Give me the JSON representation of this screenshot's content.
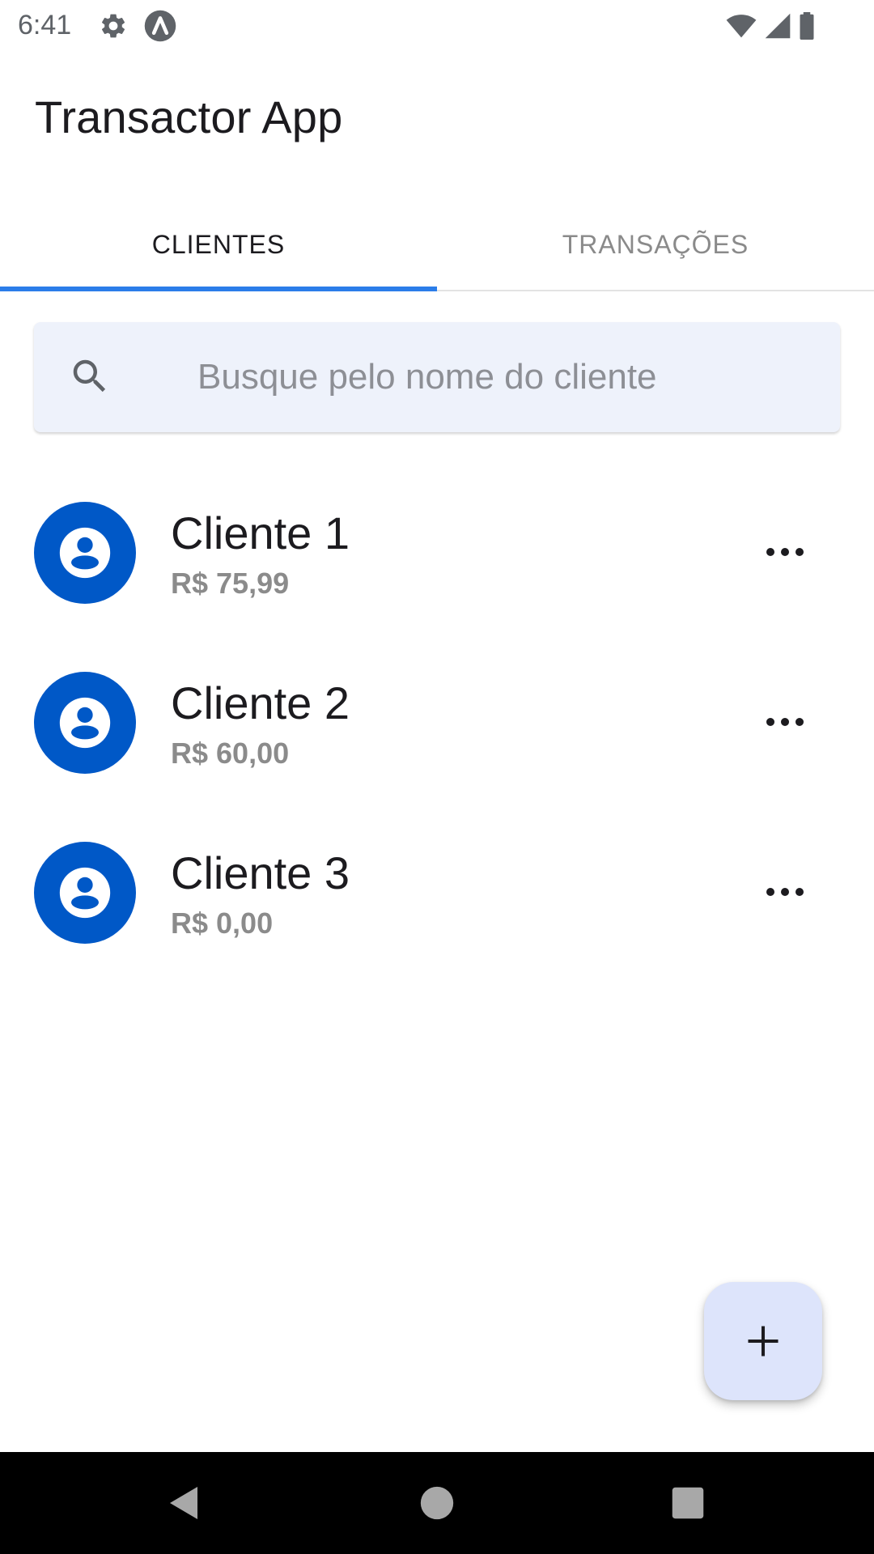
{
  "status_bar": {
    "time": "6:41",
    "icons": [
      "gear-icon",
      "a-badge-icon",
      "wifi-icon",
      "signal-icon",
      "battery-icon"
    ]
  },
  "app_bar": {
    "title": "Transactor App"
  },
  "tabs": [
    {
      "label": "CLIENTES",
      "active": true
    },
    {
      "label": "TRANSAÇÕES",
      "active": false
    }
  ],
  "search": {
    "placeholder": "Busque pelo nome do cliente",
    "value": ""
  },
  "clients": [
    {
      "name": "Cliente 1",
      "amount": "R$ 75,99"
    },
    {
      "name": "Cliente 2",
      "amount": "R$ 60,00"
    },
    {
      "name": "Cliente 3",
      "amount": "R$ 0,00"
    }
  ],
  "fab": {
    "icon": "plus-icon"
  },
  "nav_bar": {
    "icons": [
      "back-icon",
      "home-icon",
      "recents-icon"
    ]
  },
  "colors": {
    "accent": "#2b7de9",
    "avatar": "#0058c7",
    "search_bg": "#eef2fb",
    "fab_bg": "#dde4fb",
    "secondary_text": "#8b8b8b"
  }
}
